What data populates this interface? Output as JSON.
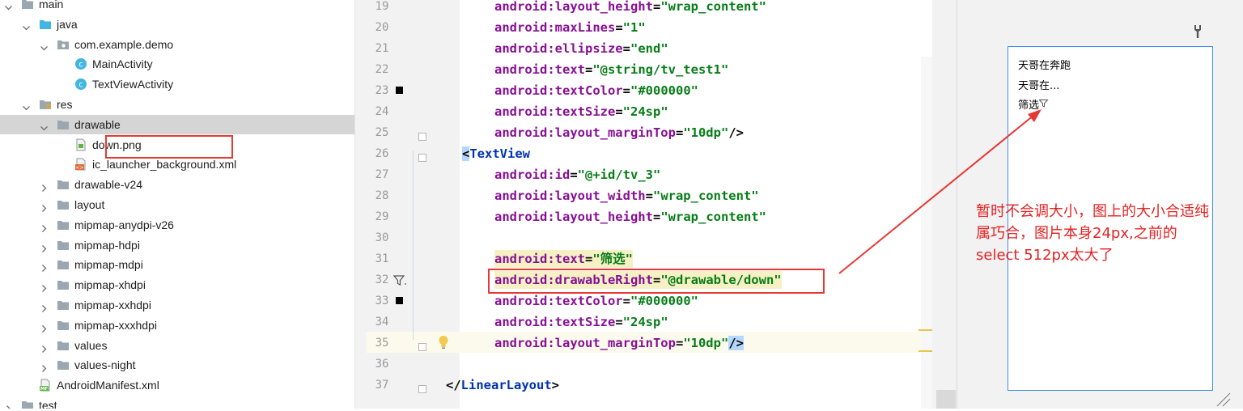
{
  "project_tree": {
    "items": [
      {
        "label": "main",
        "icon": "folder-icon",
        "expanded": true
      },
      {
        "label": "java",
        "icon": "source-folder-icon",
        "expanded": true
      },
      {
        "label": "com.example.demo",
        "icon": "package-icon",
        "expanded": true
      },
      {
        "label": "MainActivity",
        "icon": "class-icon"
      },
      {
        "label": "TextViewActivity",
        "icon": "class-icon"
      },
      {
        "label": "res",
        "icon": "resources-folder-icon",
        "expanded": true
      },
      {
        "label": "drawable",
        "icon": "folder-icon",
        "expanded": true,
        "selected": true
      },
      {
        "label": "down.png",
        "icon": "image-file-icon"
      },
      {
        "label": "ic_launcher_background.xml",
        "icon": "xml-file-icon"
      },
      {
        "label": "drawable-v24",
        "icon": "folder-icon",
        "expanded": false
      },
      {
        "label": "layout",
        "icon": "folder-icon",
        "expanded": false
      },
      {
        "label": "mipmap-anydpi-v26",
        "icon": "folder-icon",
        "expanded": false
      },
      {
        "label": "mipmap-hdpi",
        "icon": "folder-icon",
        "expanded": false
      },
      {
        "label": "mipmap-mdpi",
        "icon": "folder-icon",
        "expanded": false
      },
      {
        "label": "mipmap-xhdpi",
        "icon": "folder-icon",
        "expanded": false
      },
      {
        "label": "mipmap-xxhdpi",
        "icon": "folder-icon",
        "expanded": false
      },
      {
        "label": "mipmap-xxxhdpi",
        "icon": "folder-icon",
        "expanded": false
      },
      {
        "label": "values",
        "icon": "folder-icon",
        "expanded": false
      },
      {
        "label": "values-night",
        "icon": "folder-icon",
        "expanded": false
      },
      {
        "label": "AndroidManifest.xml",
        "icon": "manifest-file-icon"
      },
      {
        "label": "test",
        "icon": "folder-icon",
        "expanded": false
      }
    ]
  },
  "editor": {
    "lines": [
      {
        "num": "19",
        "ns": "android:",
        "attr": "layout_height",
        "val": "\"wrap_content\"",
        "end": ""
      },
      {
        "num": "20",
        "ns": "android:",
        "attr": "maxLines",
        "val": "\"1\"",
        "end": ""
      },
      {
        "num": "21",
        "ns": "android:",
        "attr": "ellipsize",
        "val": "\"end\"",
        "end": ""
      },
      {
        "num": "22",
        "ns": "android:",
        "attr": "text",
        "val": "\"@string/tv_test1\"",
        "end": ""
      },
      {
        "num": "23",
        "ns": "android:",
        "attr": "textColor",
        "val": "\"#000000\"",
        "end": ""
      },
      {
        "num": "24",
        "ns": "android:",
        "attr": "textSize",
        "val": "\"24sp\"",
        "end": ""
      },
      {
        "num": "25",
        "ns": "android:",
        "attr": "layout_marginTop",
        "val": "\"10dp\"",
        "end": "/>"
      },
      {
        "num": "26",
        "tag": "TextView"
      },
      {
        "num": "27",
        "ns": "android:",
        "attr": "id",
        "val": "\"@+id/tv_3\"",
        "end": ""
      },
      {
        "num": "28",
        "ns": "android:",
        "attr": "layout_width",
        "val": "\"wrap_content\"",
        "end": ""
      },
      {
        "num": "29",
        "ns": "android:",
        "attr": "layout_height",
        "val": "\"wrap_content\"",
        "end": ""
      },
      {
        "num": "30"
      },
      {
        "num": "31",
        "ns": "android:",
        "attr": "text",
        "val": "\"筛选\"",
        "end": ""
      },
      {
        "num": "32",
        "ns": "android:",
        "attr": "drawableRight",
        "val": "\"@drawable/down\"",
        "end": ""
      },
      {
        "num": "33",
        "ns": "android:",
        "attr": "textColor",
        "val": "\"#000000\"",
        "end": ""
      },
      {
        "num": "34",
        "ns": "android:",
        "attr": "textSize",
        "val": "\"24sp\"",
        "end": ""
      },
      {
        "num": "35",
        "ns": "android:",
        "attr": "layout_marginTop",
        "val": "\"10dp\"",
        "end": "/>"
      },
      {
        "num": "36"
      },
      {
        "num": "37",
        "closing_tag": "</LinearLayout>"
      }
    ]
  },
  "preview": {
    "line1": "天哥在奔跑",
    "line2": "天哥在...",
    "line3": "筛选"
  },
  "annotation": {
    "note_line1": "暂时不会调大小，图上的大小合适纯",
    "note_line2": "属巧合，图片本身24px,之前的",
    "note_line3": "select 512px太大了"
  },
  "colors": {
    "selection": "#d5d5d5",
    "attr_namespace": "#871094",
    "attr_value": "#067d17",
    "tag": "#0033b3",
    "annotation_red": "#e53935",
    "preview_border": "#3d8ef2"
  }
}
